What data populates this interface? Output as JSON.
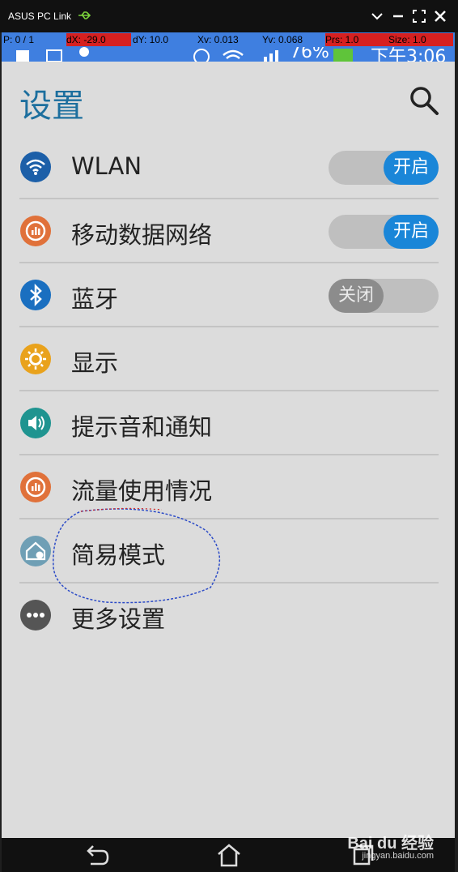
{
  "window": {
    "title": "ASUS PC Link"
  },
  "debug": {
    "p": "P: 0 / 1",
    "dx": "dX: -29.0",
    "dy": "dY: 10.0",
    "xv": "Xv: 0.013",
    "yv": "Yv: 0.068",
    "prs": "Prs: 1.0",
    "size": "Size: 1.0"
  },
  "statusbar": {
    "battery": "76%",
    "time": "下午3:06"
  },
  "settings": {
    "title": "设置",
    "items": [
      {
        "label": "WLAN",
        "icon": "wifi-icon",
        "color": "#1c5fa8",
        "toggle": "开启",
        "state": "on"
      },
      {
        "label": "移动数据网络",
        "icon": "data-icon",
        "color": "#e0713a",
        "toggle": "开启",
        "state": "on"
      },
      {
        "label": "蓝牙",
        "icon": "bluetooth-icon",
        "color": "#1a6fc0",
        "toggle": "关闭",
        "state": "off"
      },
      {
        "label": "显示",
        "icon": "brightness-icon",
        "color": "#e9a21c"
      },
      {
        "label": "提示音和通知",
        "icon": "sound-icon",
        "color": "#1f9490"
      },
      {
        "label": "流量使用情况",
        "icon": "data-usage-icon",
        "color": "#e0713a"
      },
      {
        "label": "简易模式",
        "icon": "easy-mode-icon",
        "color": "#6f9fb5"
      },
      {
        "label": "更多设置",
        "icon": "more-icon",
        "color": "#555555"
      }
    ]
  },
  "watermark": {
    "brand": "Bai du 经验",
    "url": "jingyan.baidu.com"
  }
}
